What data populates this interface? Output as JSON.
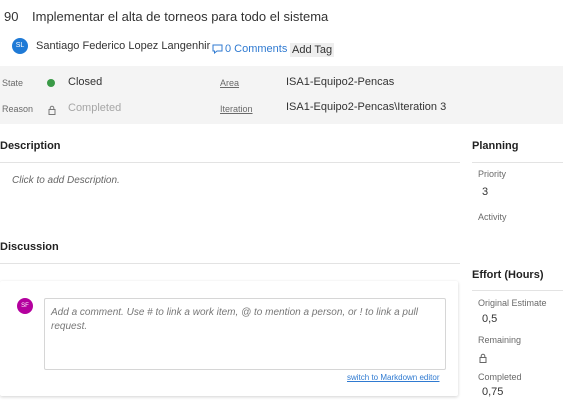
{
  "work_item": {
    "id": "90",
    "title": "Implementar el alta de torneos para todo el sistema",
    "owner": {
      "initials": "SL",
      "name": "Santiago Federico Lopez Langenhir",
      "avatar_color": "#1f7ad6"
    },
    "comments_label": "0 Comments",
    "add_tag_label": "Add Tag"
  },
  "fields": {
    "state": {
      "label": "State",
      "value": "Closed",
      "status_color": "#3a9a47"
    },
    "reason": {
      "label": "Reason",
      "value": "Completed",
      "icon": "lock-icon"
    },
    "area": {
      "label": "Area",
      "value": "ISA1-Equipo2-Pencas"
    },
    "iteration": {
      "label": "Iteration",
      "value": "ISA1-Equipo2-Pencas\\Iteration 3"
    }
  },
  "description": {
    "title": "Description",
    "placeholder": "Click to add Description."
  },
  "discussion": {
    "title": "Discussion",
    "commenter_initials": "SF",
    "commenter_color": "#b4009e",
    "comment_placeholder": "Add a comment. Use # to link a work item, @ to mention a person, or ! to link a pull request.",
    "markdown_link": "switch to Markdown editor"
  },
  "planning": {
    "title": "Planning",
    "priority_label": "Priority",
    "priority_value": "3",
    "activity_label": "Activity"
  },
  "effort": {
    "title": "Effort (Hours)",
    "original_estimate_label": "Original Estimate",
    "original_estimate_value": "0,5",
    "remaining_label": "Remaining",
    "completed_label": "Completed",
    "completed_value": "0,75"
  },
  "colors": {
    "link": "#2f7ad1",
    "band": "#f4f4f4"
  }
}
